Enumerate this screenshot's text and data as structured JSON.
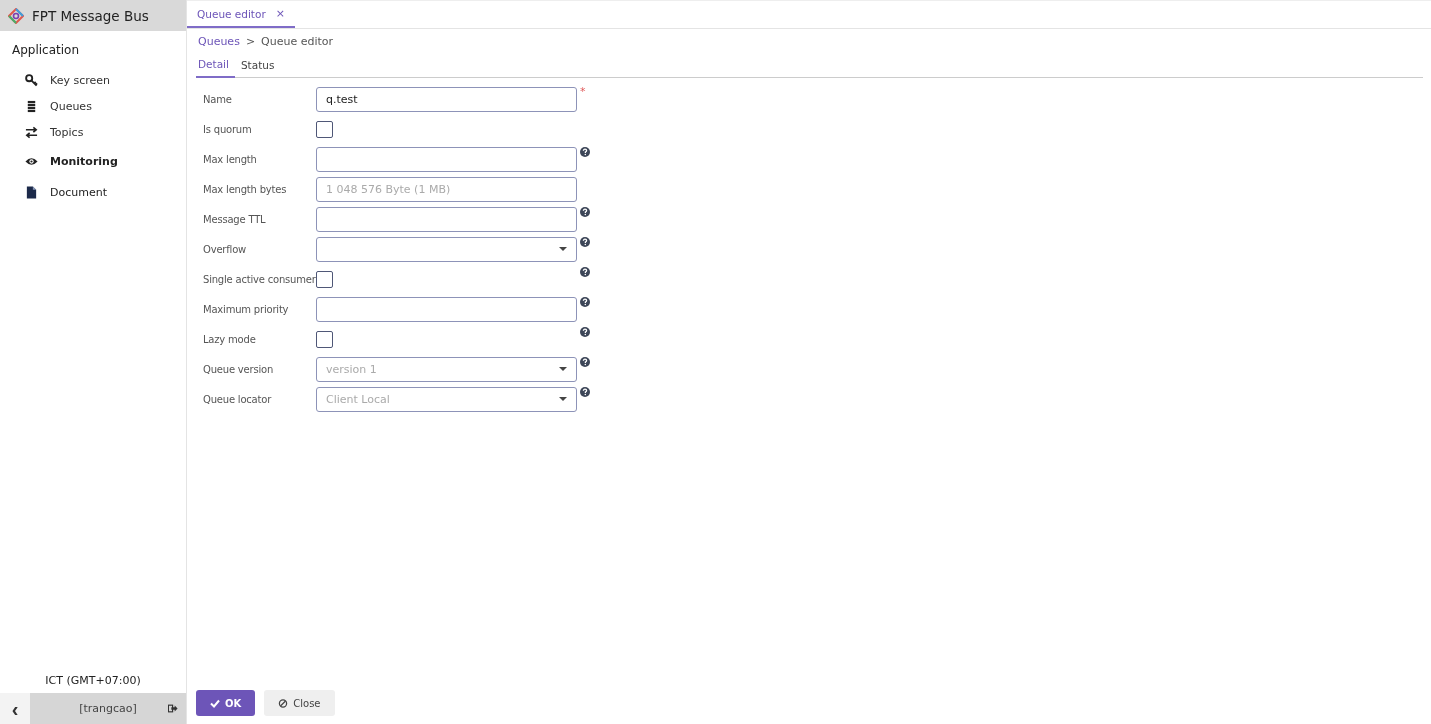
{
  "app": {
    "title": "FPT Message Bus"
  },
  "sidebar": {
    "section": "Application",
    "items": [
      {
        "label": "Key screen",
        "kind": "item"
      },
      {
        "label": "Queues",
        "kind": "item"
      },
      {
        "label": "Topics",
        "kind": "item"
      },
      {
        "label": "Monitoring",
        "kind": "group"
      },
      {
        "label": "Document",
        "kind": "group-plain"
      }
    ],
    "timezone": "ICT (GMT+07:00)",
    "user": "[trangcao]",
    "collapse": "‹"
  },
  "doc_tabs": [
    {
      "label": "Queue editor",
      "close": "×",
      "selected": true
    }
  ],
  "breadcrumb": {
    "link": "Queues",
    "separator": ">",
    "current": "Queue editor"
  },
  "tabs": [
    {
      "label": "Detail",
      "selected": true
    },
    {
      "label": "Status",
      "selected": false
    }
  ],
  "fields": [
    {
      "label": "Name",
      "kind": "text",
      "value": "q.test",
      "required": "*",
      "help": false
    },
    {
      "label": "Is quorum",
      "kind": "checkbox",
      "checked": false,
      "help": false
    },
    {
      "label": "Max length",
      "kind": "text",
      "help": true
    },
    {
      "label": "Max length bytes",
      "kind": "text",
      "placeholder": "1 048 576 Byte (1 MB)",
      "help": false
    },
    {
      "label": "Message TTL",
      "kind": "text",
      "help": true
    },
    {
      "label": "Overflow",
      "kind": "select",
      "help": true
    },
    {
      "label": "Single active consumer",
      "kind": "checkbox",
      "checked": false,
      "help": true
    },
    {
      "label": "Maximum priority",
      "kind": "text",
      "help": true
    },
    {
      "label": "Lazy mode",
      "kind": "checkbox",
      "checked": false,
      "help": true
    },
    {
      "label": "Queue version",
      "kind": "select",
      "placeholder": "version 1",
      "help": true
    },
    {
      "label": "Queue locator",
      "kind": "select",
      "placeholder": "Client Local",
      "help": true
    }
  ],
  "buttons": [
    {
      "label": "OK",
      "kind": "primary"
    },
    {
      "label": "Close",
      "kind": "secondary"
    }
  ]
}
